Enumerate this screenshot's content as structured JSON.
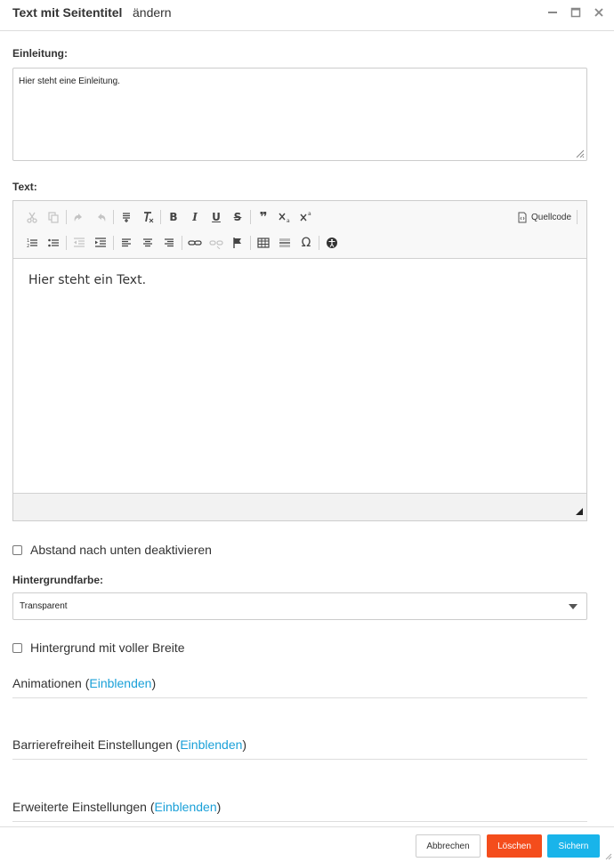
{
  "dialog": {
    "title": "Text mit Seitentitel",
    "subtitle": "ändern"
  },
  "intro": {
    "label": "Einleitung:",
    "value": "Hier steht eine Einleitung."
  },
  "text": {
    "label": "Text:",
    "source_button": "Quellcode",
    "content": "Hier steht ein Text."
  },
  "spacing": {
    "label": "Abstand nach unten deaktivieren",
    "checked": false
  },
  "background_color": {
    "label": "Hintergrundfarbe:",
    "selected": "Transparent"
  },
  "full_width": {
    "label": "Hintergrund mit voller Breite",
    "checked": false
  },
  "sections": [
    {
      "title": "Animationen",
      "link": "Einblenden"
    },
    {
      "title": "Barrierefreiheit Einstellungen",
      "link": "Einblenden"
    },
    {
      "title": "Erweiterte Einstellungen",
      "link": "Einblenden"
    }
  ],
  "footer": {
    "cancel": "Abbrechen",
    "delete": "Löschen",
    "save": "Sichern"
  },
  "colors": {
    "link": "#1aa0d8",
    "delete": "#f44d1c",
    "save": "#19b4ea"
  }
}
